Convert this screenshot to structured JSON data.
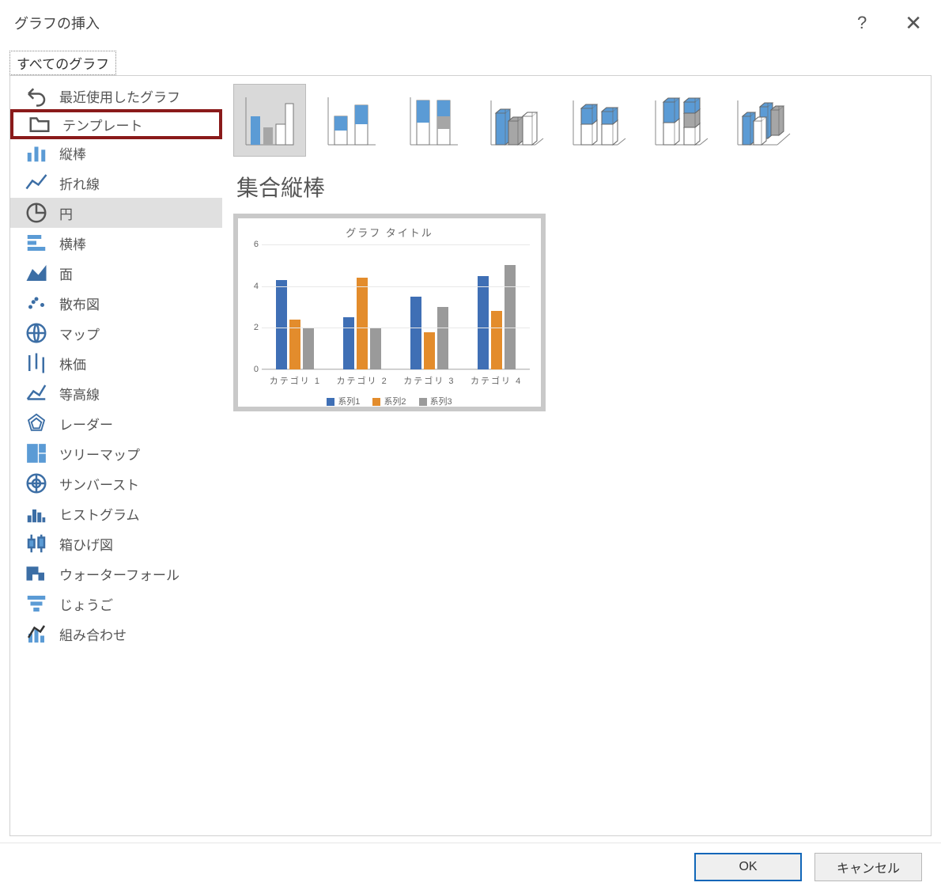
{
  "dialog": {
    "title": "グラフの挿入"
  },
  "tab": {
    "all": "すべてのグラフ"
  },
  "sidebar": {
    "items": [
      {
        "id": "recent",
        "label": "最近使用したグラフ",
        "icon": "undo-icon"
      },
      {
        "id": "templates",
        "label": "テンプレート",
        "icon": "folder-icon",
        "highlight": true
      },
      {
        "id": "column",
        "label": "縦棒",
        "icon": "column-chart-icon"
      },
      {
        "id": "line",
        "label": "折れ線",
        "icon": "line-chart-icon"
      },
      {
        "id": "pie",
        "label": "円",
        "icon": "pie-chart-icon",
        "selected": true
      },
      {
        "id": "bar",
        "label": "横棒",
        "icon": "bar-chart-icon"
      },
      {
        "id": "area",
        "label": "面",
        "icon": "area-chart-icon"
      },
      {
        "id": "scatter",
        "label": "散布図",
        "icon": "scatter-chart-icon"
      },
      {
        "id": "map",
        "label": "マップ",
        "icon": "map-chart-icon"
      },
      {
        "id": "stock",
        "label": "株価",
        "icon": "stock-chart-icon"
      },
      {
        "id": "surface",
        "label": "等高線",
        "icon": "surface-chart-icon"
      },
      {
        "id": "radar",
        "label": "レーダー",
        "icon": "radar-chart-icon"
      },
      {
        "id": "treemap",
        "label": "ツリーマップ",
        "icon": "treemap-chart-icon"
      },
      {
        "id": "sunburst",
        "label": "サンバースト",
        "icon": "sunburst-chart-icon"
      },
      {
        "id": "histogram",
        "label": "ヒストグラム",
        "icon": "histogram-chart-icon"
      },
      {
        "id": "boxwhisker",
        "label": "箱ひげ図",
        "icon": "boxwhisker-chart-icon"
      },
      {
        "id": "waterfall",
        "label": "ウォーターフォール",
        "icon": "waterfall-chart-icon"
      },
      {
        "id": "funnel",
        "label": "じょうご",
        "icon": "funnel-chart-icon"
      },
      {
        "id": "combo",
        "label": "組み合わせ",
        "icon": "combo-chart-icon"
      }
    ]
  },
  "subtype": {
    "title": "集合縦棒",
    "items": [
      {
        "id": "clustered-column",
        "selected": true
      },
      {
        "id": "stacked-column"
      },
      {
        "id": "stacked-column-100"
      },
      {
        "id": "clustered-column-3d"
      },
      {
        "id": "stacked-column-3d"
      },
      {
        "id": "stacked-column-100-3d"
      },
      {
        "id": "column-3d"
      }
    ]
  },
  "preview": {
    "title": "グラフ タイトル",
    "legend": [
      "系列1",
      "系列2",
      "系列3"
    ]
  },
  "buttons": {
    "ok": "OK",
    "cancel": "キャンセル"
  },
  "colors": {
    "series1": "#3f6fb5",
    "series2": "#e38c2c",
    "series3": "#9a9a9a",
    "accent": "#5b9bd5",
    "highlight_border": "#8a1a1a"
  },
  "chart_data": {
    "type": "bar",
    "title": "グラフ タイトル",
    "categories": [
      "カテゴリ 1",
      "カテゴリ 2",
      "カテゴリ 3",
      "カテゴリ 4"
    ],
    "series": [
      {
        "name": "系列1",
        "values": [
          4.3,
          2.5,
          3.5,
          4.5
        ]
      },
      {
        "name": "系列2",
        "values": [
          2.4,
          4.4,
          1.8,
          2.8
        ]
      },
      {
        "name": "系列3",
        "values": [
          2.0,
          2.0,
          3.0,
          5.0
        ]
      }
    ],
    "ylabel": "",
    "xlabel": "",
    "ylim": [
      0,
      6
    ],
    "yticks": [
      0,
      2,
      4,
      6
    ]
  }
}
